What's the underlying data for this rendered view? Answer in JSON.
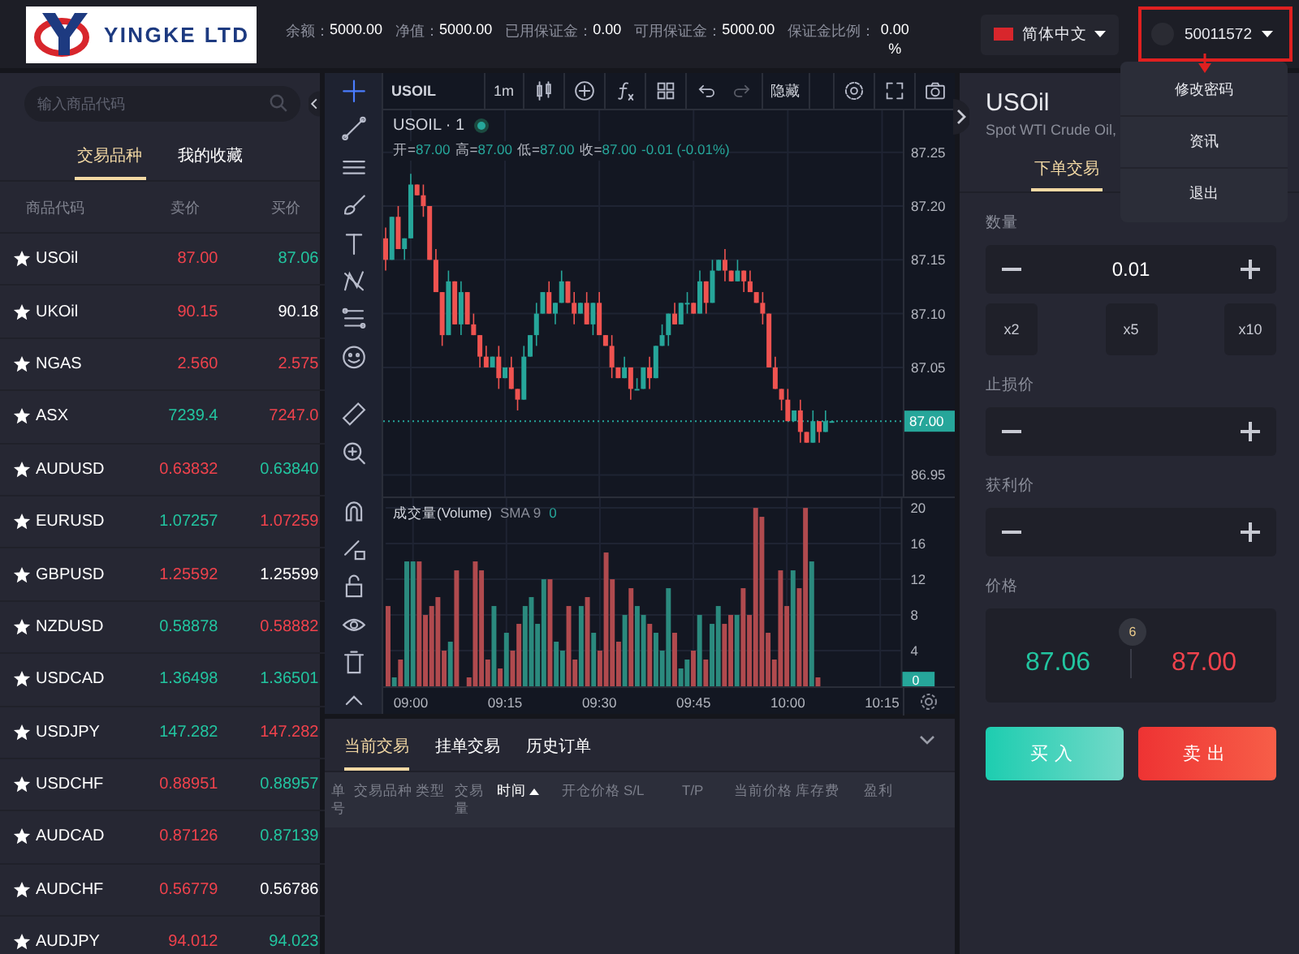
{
  "header": {
    "logo": {
      "text": "YINGKE LTD"
    },
    "stats": [
      {
        "label": "余额：",
        "value": "5000.00"
      },
      {
        "label": "净值：",
        "value": "5000.00"
      },
      {
        "label": "已用保证金：",
        "value": "0.00"
      },
      {
        "label": "可用保证金：",
        "value": "5000.00"
      },
      {
        "label": "保证金比例：",
        "value": "0.00 %"
      }
    ],
    "language": "简体中文",
    "account": {
      "number": "50011572",
      "highlighted": true
    }
  },
  "account_menu": {
    "items": [
      "修改密码",
      "资讯",
      "退出"
    ]
  },
  "market": {
    "search": {
      "placeholder": "输入商品代码"
    },
    "tabs": [
      {
        "label": "交易品种",
        "selected": true
      },
      {
        "label": "我的收藏",
        "selected": false
      }
    ],
    "columns": [
      "商品代码",
      "卖价",
      "买价"
    ],
    "rows": [
      {
        "symbol": "USOil",
        "bid": {
          "text": "87.00",
          "color": "#f0424c"
        },
        "ask": {
          "text": "87.06",
          "color": "#22c5a0"
        }
      },
      {
        "symbol": "UKOil",
        "bid": {
          "text": "90.15",
          "color": "#f0424c"
        },
        "ask": {
          "text": "90.18",
          "color": "#ffffff"
        }
      },
      {
        "symbol": "NGAS",
        "bid": {
          "text": "2.560",
          "color": "#f0424c"
        },
        "ask": {
          "text": "2.575",
          "color": "#f0424c"
        }
      },
      {
        "symbol": "ASX",
        "bid": {
          "text": "7239.4",
          "color": "#22c5a0"
        },
        "ask": {
          "text": "7247.0",
          "color": "#f0424c"
        }
      },
      {
        "symbol": "AUDUSD",
        "bid": {
          "text": "0.63832",
          "color": "#f0424c"
        },
        "ask": {
          "text": "0.63840",
          "color": "#22c5a0"
        }
      },
      {
        "symbol": "EURUSD",
        "bid": {
          "text": "1.07257",
          "color": "#22c5a0"
        },
        "ask": {
          "text": "1.07259",
          "color": "#f0424c"
        }
      },
      {
        "symbol": "GBPUSD",
        "bid": {
          "text": "1.25592",
          "color": "#f0424c"
        },
        "ask": {
          "text": "1.25599",
          "color": "#ffffff"
        }
      },
      {
        "symbol": "NZDUSD",
        "bid": {
          "text": "0.58878",
          "color": "#22c5a0"
        },
        "ask": {
          "text": "0.58882",
          "color": "#f0424c"
        }
      },
      {
        "symbol": "USDCAD",
        "bid": {
          "text": "1.36498",
          "color": "#22c5a0"
        },
        "ask": {
          "text": "1.36501",
          "color": "#22c5a0"
        }
      },
      {
        "symbol": "USDJPY",
        "bid": {
          "text": "147.282",
          "color": "#22c5a0"
        },
        "ask": {
          "text": "147.282",
          "color": "#f0424c"
        }
      },
      {
        "symbol": "USDCHF",
        "bid": {
          "text": "0.88951",
          "color": "#f0424c"
        },
        "ask": {
          "text": "0.88957",
          "color": "#22c5a0"
        }
      },
      {
        "symbol": "AUDCAD",
        "bid": {
          "text": "0.87126",
          "color": "#f0424c"
        },
        "ask": {
          "text": "0.87139",
          "color": "#22c5a0"
        }
      },
      {
        "symbol": "AUDCHF",
        "bid": {
          "text": "0.56779",
          "color": "#f0424c"
        },
        "ask": {
          "text": "0.56786",
          "color": "#ffffff"
        }
      },
      {
        "symbol": "AUDJPY",
        "bid": {
          "text": "94.012",
          "color": "#f0424c"
        },
        "ask": {
          "text": "94.023",
          "color": "#22c5a0"
        }
      }
    ]
  },
  "chart": {
    "symbol": "USOIL",
    "interval": "1m",
    "hide_label": "隐藏",
    "legend": {
      "title": "USOIL · 1",
      "ohlc": [
        {
          "label": "开=",
          "value": "87.00"
        },
        {
          "label": "高=",
          "value": "87.00"
        },
        {
          "label": "低=",
          "value": "87.00"
        },
        {
          "label": "收=",
          "value": "87.00"
        }
      ],
      "change": "-0.01 (-0.01%)"
    },
    "price_pane": {
      "last_price": "87.00",
      "chart_data": {
        "type": "candlestick",
        "grid": true,
        "categories": [
          null,
          null,
          null,
          null,
          null,
          null,
          null,
          null,
          null,
          null,
          null,
          null,
          null,
          null,
          null,
          null,
          null,
          null,
          null,
          null,
          null,
          null,
          null,
          null,
          null,
          null,
          null,
          null,
          null,
          null,
          null,
          null,
          null,
          null,
          null,
          null,
          null,
          null,
          null,
          null,
          null,
          null,
          null,
          null,
          null,
          null,
          null,
          null,
          null,
          null,
          null,
          null,
          null,
          null,
          null,
          null,
          null,
          null,
          null,
          null,
          null,
          null,
          null,
          null,
          null,
          null,
          null,
          null,
          null,
          null,
          null,
          null,
          null,
          null,
          null,
          null,
          null,
          null,
          null,
          null
        ],
        "ohlc": [
          [
            87.17,
            87.18,
            87.14,
            87.15
          ],
          [
            87.15,
            87.19,
            87.15,
            87.19
          ],
          [
            87.19,
            87.2,
            87.16,
            87.16
          ],
          [
            87.16,
            87.17,
            87.15,
            87.17
          ],
          [
            87.17,
            87.23,
            87.17,
            87.22
          ],
          [
            87.22,
            87.22,
            87.21,
            87.21
          ],
          [
            87.21,
            87.22,
            87.19,
            87.2
          ],
          [
            87.2,
            87.2,
            87.15,
            87.15
          ],
          [
            87.15,
            87.16,
            87.12,
            87.12
          ],
          [
            87.12,
            87.12,
            87.07,
            87.08
          ],
          [
            87.08,
            87.14,
            87.08,
            87.13
          ],
          [
            87.13,
            87.13,
            87.09,
            87.09
          ],
          [
            87.09,
            87.13,
            87.08,
            87.12
          ],
          [
            87.12,
            87.12,
            87.09,
            87.09
          ],
          [
            87.09,
            87.1,
            87.08,
            87.08
          ],
          [
            87.08,
            87.08,
            87.05,
            87.06
          ],
          [
            87.06,
            87.07,
            87.05,
            87.05
          ],
          [
            87.05,
            87.06,
            87.05,
            87.06
          ],
          [
            87.06,
            87.07,
            87.03,
            87.04
          ],
          [
            87.04,
            87.05,
            87.04,
            87.05
          ],
          [
            87.05,
            87.06,
            87.03,
            87.03
          ],
          [
            87.03,
            87.03,
            87.01,
            87.02
          ],
          [
            87.02,
            87.07,
            87.02,
            87.06
          ],
          [
            87.06,
            87.08,
            87.06,
            87.08
          ],
          [
            87.08,
            87.11,
            87.07,
            87.1
          ],
          [
            87.1,
            87.12,
            87.1,
            87.12
          ],
          [
            87.12,
            87.13,
            87.1,
            87.1
          ],
          [
            87.1,
            87.11,
            87.09,
            87.11
          ],
          [
            87.11,
            87.14,
            87.11,
            87.13
          ],
          [
            87.13,
            87.13,
            87.11,
            87.11
          ],
          [
            87.11,
            87.12,
            87.09,
            87.1
          ],
          [
            87.1,
            87.11,
            87.1,
            87.11
          ],
          [
            87.11,
            87.12,
            87.09,
            87.09
          ],
          [
            87.09,
            87.11,
            87.08,
            87.11
          ],
          [
            87.11,
            87.12,
            87.08,
            87.08
          ],
          [
            87.08,
            87.08,
            87.07,
            87.07
          ],
          [
            87.07,
            87.08,
            87.04,
            87.05
          ],
          [
            87.05,
            87.05,
            87.04,
            87.04
          ],
          [
            87.04,
            87.06,
            87.04,
            87.05
          ],
          [
            87.05,
            87.05,
            87.02,
            87.03
          ],
          [
            87.03,
            87.04,
            87.03,
            87.03
          ],
          [
            87.03,
            87.05,
            87.03,
            87.05
          ],
          [
            87.05,
            87.06,
            87.03,
            87.04
          ],
          [
            87.04,
            87.07,
            87.04,
            87.07
          ],
          [
            87.07,
            87.09,
            87.07,
            87.08
          ],
          [
            87.08,
            87.1,
            87.07,
            87.1
          ],
          [
            87.1,
            87.11,
            87.09,
            87.09
          ],
          [
            87.09,
            87.11,
            87.09,
            87.11
          ],
          [
            87.11,
            87.12,
            87.1,
            87.11
          ],
          [
            87.11,
            87.11,
            87.1,
            87.1
          ],
          [
            87.1,
            87.14,
            87.1,
            87.13
          ],
          [
            87.13,
            87.13,
            87.1,
            87.11
          ],
          [
            87.11,
            87.15,
            87.11,
            87.14
          ],
          [
            87.14,
            87.15,
            87.14,
            87.15
          ],
          [
            87.15,
            87.16,
            87.13,
            87.14
          ],
          [
            87.14,
            87.14,
            87.13,
            87.13
          ],
          [
            87.13,
            87.15,
            87.13,
            87.14
          ],
          [
            87.14,
            87.14,
            87.12,
            87.13
          ],
          [
            87.13,
            87.14,
            87.12,
            87.12
          ],
          [
            87.12,
            87.12,
            87.11,
            87.11
          ],
          [
            87.11,
            87.12,
            87.09,
            87.1
          ],
          [
            87.1,
            87.1,
            87.05,
            87.05
          ],
          [
            87.05,
            87.06,
            87.03,
            87.03
          ],
          [
            87.03,
            87.03,
            87.01,
            87.02
          ],
          [
            87.02,
            87.03,
            87.0,
            87.0
          ],
          [
            87.0,
            87.01,
            87.0,
            87.01
          ],
          [
            87.01,
            87.02,
            86.98,
            86.99
          ],
          [
            86.99,
            86.99,
            86.98,
            86.98
          ],
          [
            86.98,
            87.01,
            86.98,
            87.0
          ],
          [
            87.0,
            87.0,
            86.98,
            86.99
          ],
          [
            86.99,
            87.01,
            86.99,
            87.0
          ],
          [
            87.0,
            87.0,
            87.0,
            87.0
          ],
          null,
          null,
          null,
          null,
          null,
          null,
          null,
          null
        ],
        "ref_lines": [
          {
            "axis": "y",
            "value": 87.0
          }
        ],
        "ylim": [
          86.93,
          87.289
        ],
        "yticks": [
          {
            "value": 87.25,
            "label": "87.25"
          },
          {
            "value": 87.2,
            "label": "87.20"
          },
          {
            "value": 87.15,
            "label": "87.15"
          },
          {
            "value": 87.1,
            "label": "87.10"
          },
          {
            "value": 87.05,
            "label": "87.05"
          },
          {
            "value": 86.95,
            "label": "86.95"
          }
        ]
      }
    },
    "volume_legend": {
      "title": "成交量(Volume)",
      "indicator": "SMA 9",
      "value": "0"
    },
    "volume_pane": {
      "last_value": "0",
      "chart_data": {
        "type": "bar",
        "grid": true,
        "categories": [
          null,
          null,
          null,
          null,
          "09:00",
          null,
          null,
          null,
          null,
          null,
          null,
          null,
          null,
          null,
          null,
          null,
          null,
          null,
          null,
          "09:15",
          null,
          null,
          null,
          null,
          null,
          null,
          null,
          null,
          null,
          null,
          null,
          null,
          null,
          null,
          "09:30",
          null,
          null,
          null,
          null,
          null,
          null,
          null,
          null,
          null,
          null,
          null,
          null,
          null,
          null,
          "09:45",
          null,
          null,
          null,
          null,
          null,
          null,
          null,
          null,
          null,
          null,
          null,
          null,
          null,
          null,
          "10:00",
          null,
          null,
          null,
          null,
          null,
          null,
          null,
          null,
          null,
          null,
          null,
          null,
          null,
          null,
          "10:15"
        ],
        "values": [
          9,
          1,
          3,
          14,
          14,
          14,
          8,
          9,
          10,
          4,
          5,
          13,
          0,
          1,
          14,
          13,
          3,
          9,
          2,
          6,
          4,
          7,
          9,
          10,
          7,
          12,
          12,
          5,
          4,
          9,
          3,
          9,
          10,
          6,
          4,
          15,
          12,
          5,
          8,
          11,
          9,
          8,
          7,
          6,
          4,
          11,
          6,
          2,
          3,
          4,
          8,
          3,
          7,
          9,
          7,
          8,
          8,
          11,
          8,
          20,
          19,
          6,
          3,
          13,
          9,
          13,
          11,
          20,
          14,
          1,
          0,
          0,
          null,
          null,
          null,
          null,
          null,
          null,
          null,
          null
        ],
        "ylim": [
          0,
          21.1
        ],
        "yticks": [
          {
            "value": 4,
            "label": "4"
          },
          {
            "value": 8,
            "label": "8"
          },
          {
            "value": 12,
            "label": "12"
          },
          {
            "value": 16,
            "label": "16"
          },
          {
            "value": 20,
            "label": "20"
          }
        ]
      }
    }
  },
  "orders": {
    "tabs": [
      {
        "label": "当前交易",
        "selected": true
      },
      {
        "label": "挂单交易",
        "selected": false
      },
      {
        "label": "历史订单",
        "selected": false
      }
    ],
    "columns": [
      {
        "label": "单号",
        "sorted": false
      },
      {
        "label": "交易品种",
        "sorted": false
      },
      {
        "label": "类型",
        "sorted": false
      },
      {
        "label": "交易量",
        "sorted": false
      },
      {
        "label": "时间",
        "sorted": true
      },
      {
        "label": "开仓价格",
        "sorted": false
      },
      {
        "label": "S/L",
        "sorted": false
      },
      {
        "label": "T/P",
        "sorted": false
      },
      {
        "label": "当前价格",
        "sorted": false
      },
      {
        "label": "库存费",
        "sorted": false
      },
      {
        "label": "盈利",
        "sorted": false
      }
    ]
  },
  "order_form": {
    "symbol": "USOil",
    "description": "Spot WTI Crude Oil,",
    "tabs": [
      {
        "label": "下单交易",
        "selected": true
      }
    ],
    "quantity": {
      "label": "数量",
      "value": "0.01"
    },
    "multipliers": [
      "x2",
      "x5",
      "x10"
    ],
    "stop_loss": {
      "label": "止损价"
    },
    "take_profit": {
      "label": "获利价"
    },
    "price": {
      "label": "价格",
      "spread": "6",
      "buy": "87.06",
      "sell": "87.00"
    },
    "buttons": {
      "buy": "买入",
      "sell": "卖出"
    }
  }
}
